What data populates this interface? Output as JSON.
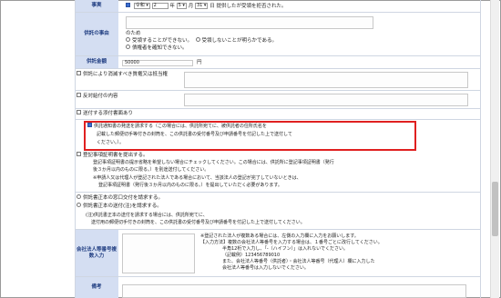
{
  "jijitsu": {
    "label": "事実",
    "era_value": "令和",
    "year_value": "2",
    "year_unit": "年",
    "month_value": "5",
    "month_unit": "月",
    "day_value": "31",
    "day_unit": "日",
    "suffix": "提供したが受領を拒否された。"
  },
  "kyotaku_jiyu": {
    "label": "供託の事由",
    "tame": "のため",
    "option1": "受領することができない。",
    "option2": "受領しないことが明らかである。",
    "option3": "債権者を確知できない。"
  },
  "kyotaku_kingaku": {
    "label": "供託金額",
    "value": "50000",
    "unit": "円"
  },
  "checks": {
    "shometsu": "供託により消滅すべき質権又は抵当権",
    "hantai_kyufu": "反対給付の内容",
    "tenpu_shomen": "送付する添付書面あり"
  },
  "highlight": {
    "line1": "供託通知書の発送を請求する（この場合には、供託所宛てに、被供託者の住所氏名を",
    "line2": "記載した郵便切手等付きの封筒を、この供託書の受付番号及び申請番号を付記した上で送付して",
    "line3": "ください。）。"
  },
  "toki": {
    "title": "登記事項証明書を提出する。",
    "line1": "登記事項証明書の提示省略を希望しない場合にチェックしてください。この場合には、供託所に登記事項証明書（発行",
    "line2": "後３か月以内のものに限る。）を別途送付してください。",
    "line3": "※申請人又は代理人が登記された法人である場合において、当該法人の登記が完了していないときは、",
    "line4": "登記事項証明書（発行後３か月以内のものに限る。）を提出していただく必要があります。"
  },
  "shosho": {
    "opt1": "供託書正本の窓口交付を請求する。",
    "opt2": "供託書正本の送付(注)を請求する。",
    "note1": "(注)供託書正本の送付を請求する場合には、供託所宛てに、",
    "note2": "送付用の郵便切手付きの封筒を、この供託書の受付番号及び申請番号を付記した上で送付してください。"
  },
  "kaisha": {
    "label": "会社法人等番号複数入力",
    "note1": "※登記された法人が複数ある場合には、左側の入力欄に入力をお願いします。",
    "note2": "【入力方法】複数の会社法人等番号を入力する場合は、１番号ごとに改行してください。",
    "note3": "半角12桁で入力し、「-（ハイフン）」は入れないでください。",
    "note4": "（記載例）123456789010",
    "note5": "また、会社法人等番号（供託者）・会社法人等番号（代理人）欄に入力した",
    "note6": "会社法人等番号は入力しないでください。",
    "input_value": ""
  },
  "biko": {
    "label": "備考"
  }
}
